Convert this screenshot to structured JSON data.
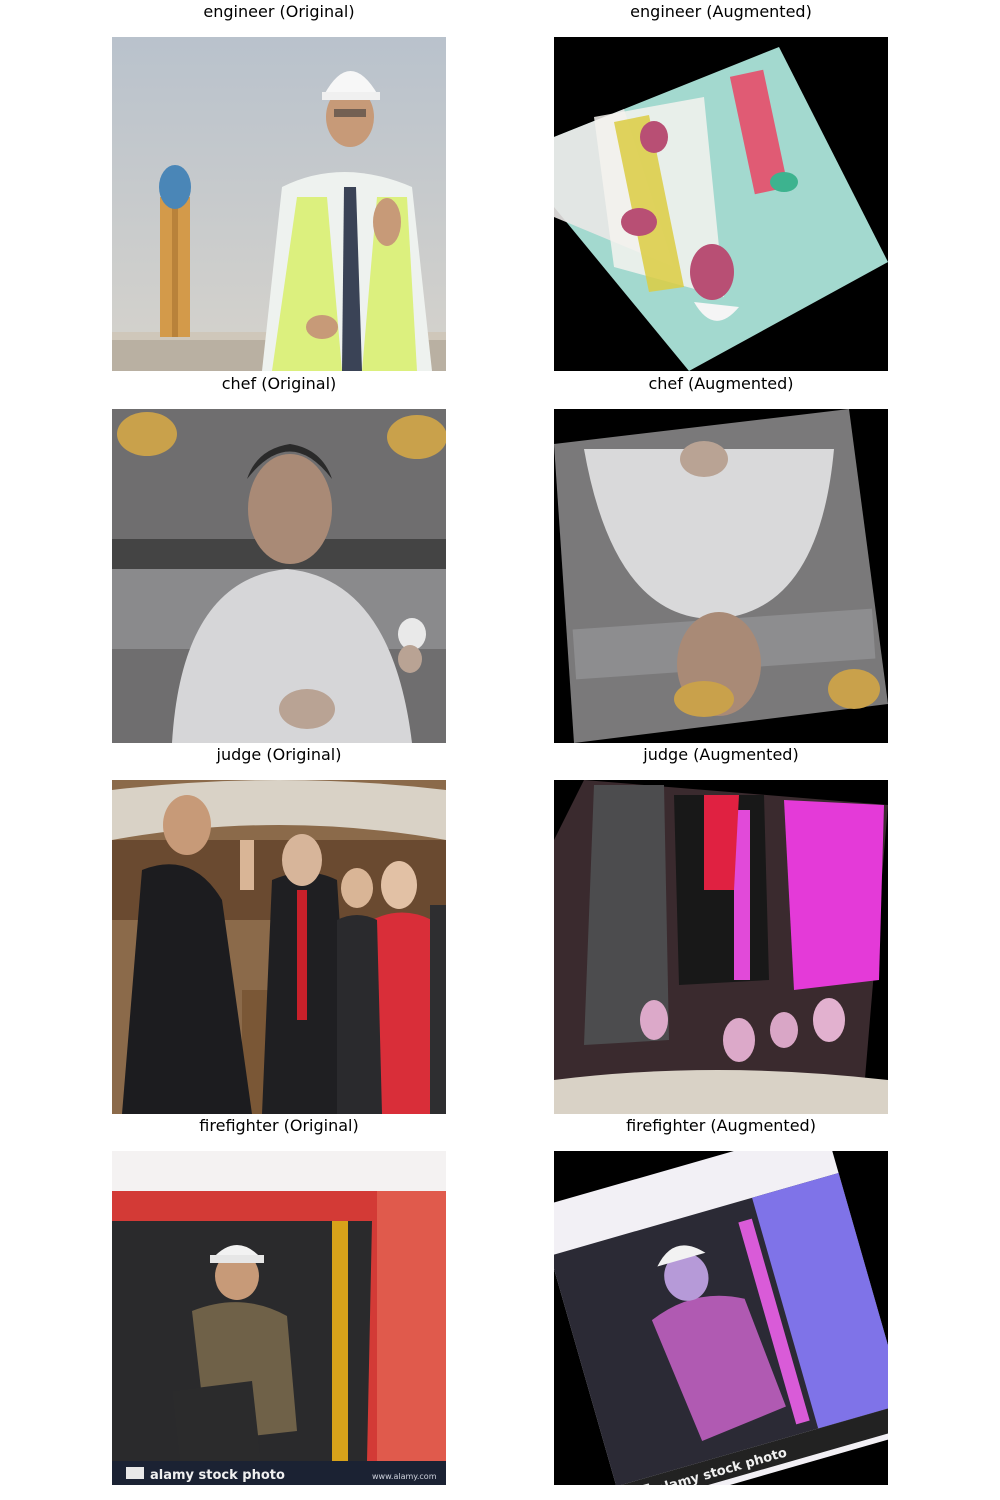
{
  "panels": [
    {
      "title": "engineer (Original)"
    },
    {
      "title": "engineer (Augmented)"
    },
    {
      "title": "chef (Original)"
    },
    {
      "title": "chef (Augmented)"
    },
    {
      "title": "judge (Original)"
    },
    {
      "title": "judge (Augmented)"
    },
    {
      "title": "firefighter (Original)"
    },
    {
      "title": "firefighter (Augmented)"
    }
  ],
  "watermark": "alamy stock photo",
  "watermark_url": "www.alamy.com",
  "colors": {
    "background": "#ffffff",
    "augment_fill": "#000000"
  }
}
